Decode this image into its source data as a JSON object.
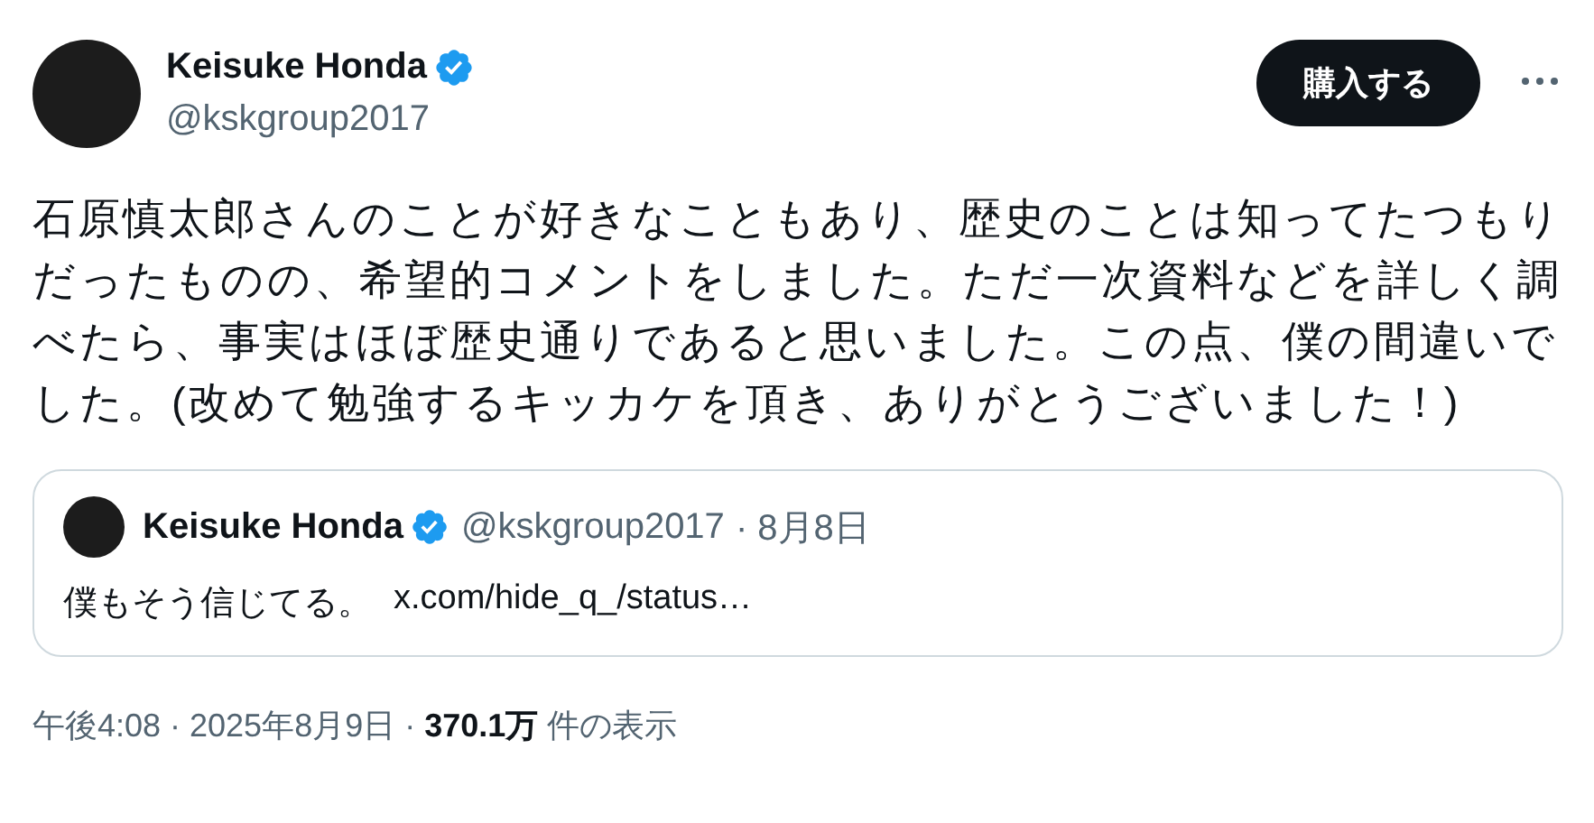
{
  "author": {
    "name": "Keisuke Honda",
    "verified": true,
    "handle": "@kskgroup2017"
  },
  "buy_button": "購入する",
  "text": "石原慎太郎さんのことが好きなこともあり、歴史のことは知ってたつもりだったものの、希望的コメントをしました。ただ一次資料などを詳しく調べたら、事実はほぼ歴史通りであると思いました。この点、僕の間違いでした。(改めて勉強するキッカケを頂き、ありがとうございました！)",
  "quote": {
    "name": "Keisuke Honda",
    "verified": true,
    "handle": "@kskgroup2017",
    "date": "· 8月8日",
    "text": "僕もそう信じてる。",
    "link": "x.com/hide_q_/status…"
  },
  "meta": "午後4:08 · 2025年8月9日 · **370.1万** 件の表示"
}
